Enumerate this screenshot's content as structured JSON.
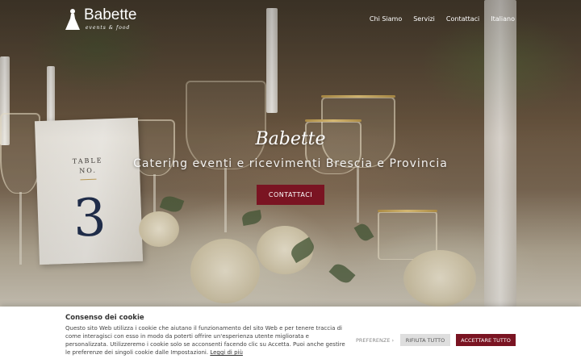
{
  "header": {
    "logo_name": "Babette",
    "logo_sub": "events & food",
    "nav": [
      "Chi Siamo",
      "Servizi",
      "Contattaci",
      "Italiano"
    ]
  },
  "hero": {
    "brand": "Babette",
    "tagline": "Catering eventi e ricevimenti Brescia e Provincia",
    "cta": "CONTATTACI",
    "table_card": {
      "label_1": "TABLE",
      "label_2": "NO.",
      "number": "3"
    }
  },
  "cookie": {
    "title": "Consenso dei cookie",
    "text": "Questo sito Web utilizza i cookie che aiutano il funzionamento del sito Web e per tenere traccia di come interagisci con esso in modo da poterti offrire un'esperienza utente migliorata e personalizzata. Utilizzeremo i cookie solo se acconsenti facendo clic su Accetta. Puoi anche gestire le preferenze dei singoli cookie dalle Impostazioni.",
    "link": "Leggi di più",
    "pref_button": "PREFERENZE ›",
    "reject_button": "RIFIUTA TUTTO",
    "accept_button": "ACCETTARE TUTTO"
  },
  "colors": {
    "accent": "#7a1422",
    "white": "#ffffff"
  }
}
